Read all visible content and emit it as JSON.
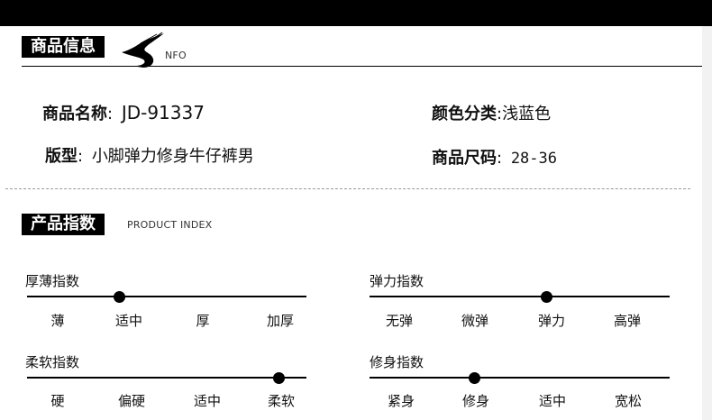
{
  "header": {
    "title": "商品信息",
    "subtitle": "NFO"
  },
  "info": {
    "name_key": "商品名称",
    "name_sep": ":",
    "name_value": "JD-91337",
    "color_key": "颜色分类",
    "color_sep": ":",
    "color_value": "浅蓝色",
    "style_key": "版型",
    "style_sep": ":",
    "style_value": "小脚弹力修身牛仔裤男",
    "size_key": "商品尺码",
    "size_sep": ":",
    "size_value": "28-36"
  },
  "product_index": {
    "title": "产品指数",
    "subtitle": "PRODUCT INDEX",
    "indices": [
      {
        "name": "厚薄指数",
        "options": [
          "薄",
          "适中",
          "厚",
          "加厚"
        ],
        "selected_position": 0.33
      },
      {
        "name": "弹力指数",
        "options": [
          "无弹",
          "微弹",
          "弹力",
          "高弹"
        ],
        "selected_position": 0.59
      },
      {
        "name": "柔软指数",
        "options": [
          "硬",
          "偏硬",
          "适中",
          "柔软"
        ],
        "selected_position": 0.9
      },
      {
        "name": "修身指数",
        "options": [
          "紧身",
          "修身",
          "适中",
          "宽松"
        ],
        "selected_position": 0.35
      }
    ]
  },
  "colors": {
    "background": "#ffffff",
    "label_bg": "#000000",
    "label_text": "#ffffff",
    "text": "#111111"
  }
}
